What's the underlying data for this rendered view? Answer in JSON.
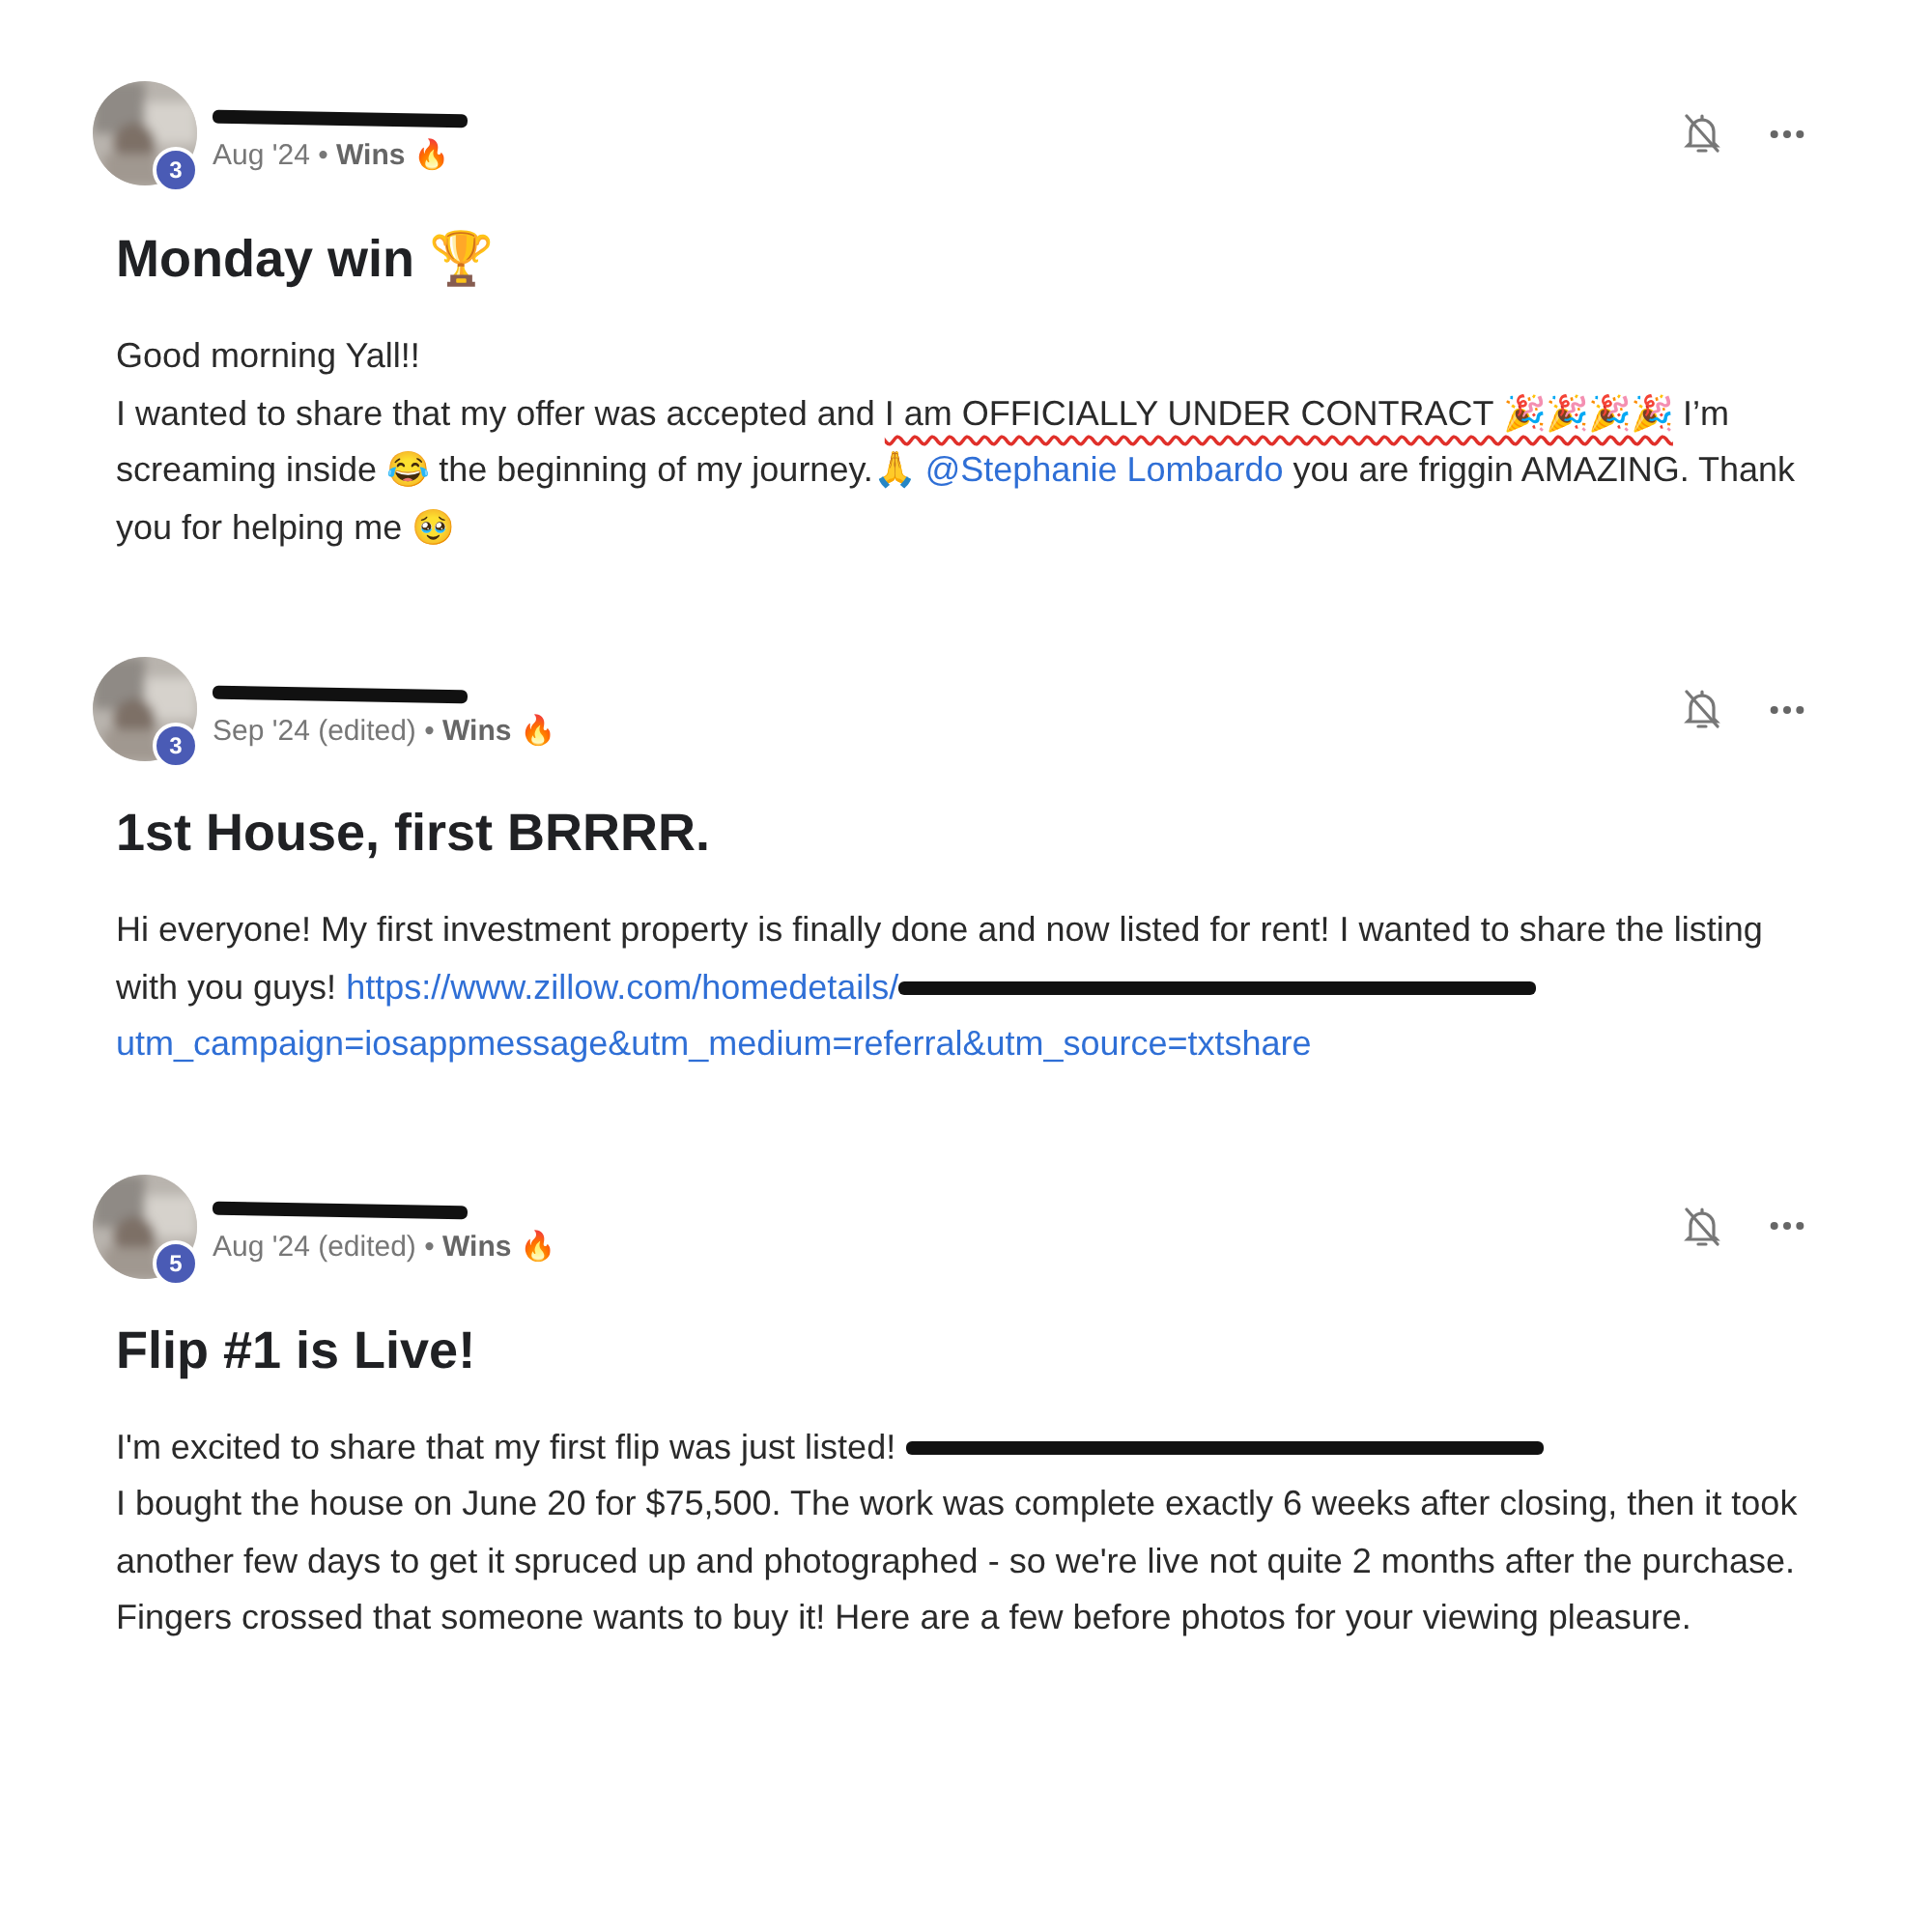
{
  "posts": [
    {
      "level": "3",
      "meta": "Aug '24 • **Wins** 🔥",
      "title": "Monday win 🏆",
      "paragraphs": [
        [
          {
            "kind": "text",
            "text": "Good morning Yall!!"
          }
        ],
        [
          {
            "kind": "text",
            "text": "I wanted to share that my offer was accepted and "
          },
          {
            "kind": "underlined",
            "text": "I am OFFICIALLY UNDER CONTRACT 🎉🎉🎉🎉"
          },
          {
            "kind": "text",
            "text": " I’m screaming inside 😂 the beginning of my journey.🙏 "
          },
          {
            "kind": "link",
            "text": "@Stephanie Lombardo"
          },
          {
            "kind": "text",
            "text": " you are friggin AMAZING. Thank you for helping me 🥹"
          }
        ]
      ]
    },
    {
      "level": "3",
      "meta": "Sep '24 (edited) • **Wins** 🔥",
      "title": "1st House, first BRRRR.",
      "paragraphs": [
        [
          {
            "kind": "text",
            "text": "Hi everyone! My first investment property is finally done and now listed for rent! I wanted to share the listing with you guys! "
          },
          {
            "kind": "link",
            "text": "https://www.zillow.com/homedetails/"
          },
          {
            "kind": "redacted"
          },
          {
            "kind": "link",
            "text": "utm_campaign=iosappmessage&utm_medium=referral&utm_source=txtshare"
          }
        ]
      ]
    },
    {
      "level": "5",
      "meta": "Aug '24 (edited) • **Wins** 🔥",
      "title": "Flip #1 is Live!",
      "paragraphs": [
        [
          {
            "kind": "text",
            "text": "I'm excited to share that my first flip was just listed! "
          },
          {
            "kind": "redacted"
          }
        ],
        [
          {
            "kind": "text",
            "text": "I bought the house on June 20 for $75,500. The work was complete exactly 6 weeks after closing, then it took another few days to get it spruced up and photographed - so we're live not quite 2 months after the purchase. Fingers crossed that someone wants to buy it! Here are a few before photos for your viewing pleasure."
          }
        ]
      ]
    }
  ]
}
